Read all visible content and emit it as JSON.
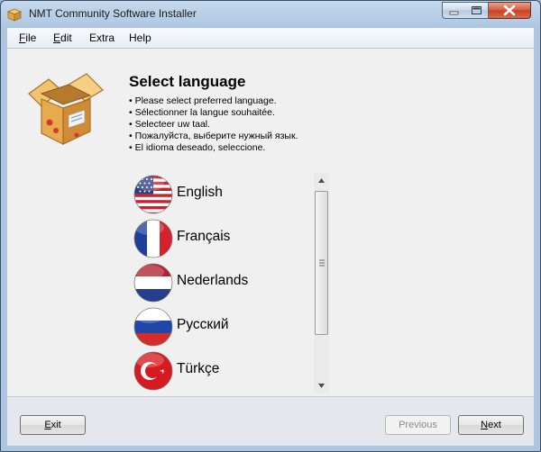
{
  "window": {
    "title": "NMT Community Software Installer",
    "controls": {
      "minimize": "minimize-icon",
      "maximize": "maximize-icon",
      "close": "close-icon"
    }
  },
  "menu": [
    {
      "label_mnemonic": "F",
      "label_rest": "ile"
    },
    {
      "label_mnemonic": "E",
      "label_rest": "dit"
    },
    {
      "label_mnemonic": "",
      "label_rest": "Extra"
    },
    {
      "label_mnemonic": "",
      "label_rest": "Help"
    }
  ],
  "page": {
    "heading": "Select language",
    "bullets": [
      "Please select preferred language.",
      "Sélectionner la langue souhaitée.",
      "Selecteer uw taal.",
      "Пожалуйста, выберите нужный язык.",
      "El idioma deseado, seleccione."
    ]
  },
  "languages": [
    {
      "label": "English",
      "flag": "us-flag-icon"
    },
    {
      "label": "Français",
      "flag": "france-flag-icon"
    },
    {
      "label": "Nederlands",
      "flag": "netherlands-flag-icon"
    },
    {
      "label": "Русский",
      "flag": "russia-flag-icon"
    },
    {
      "label": "Türkçe",
      "flag": "turkey-flag-icon"
    }
  ],
  "buttons": {
    "exit": {
      "mnemonic": "E",
      "rest": "xit"
    },
    "previous": {
      "label": "Previous",
      "disabled": true
    },
    "next": {
      "mnemonic": "N",
      "rest": "ext"
    }
  },
  "colors": {
    "titlebar": "#b7cde6",
    "close_button": "#c7401f",
    "content_bg": "#f0f0f0"
  }
}
